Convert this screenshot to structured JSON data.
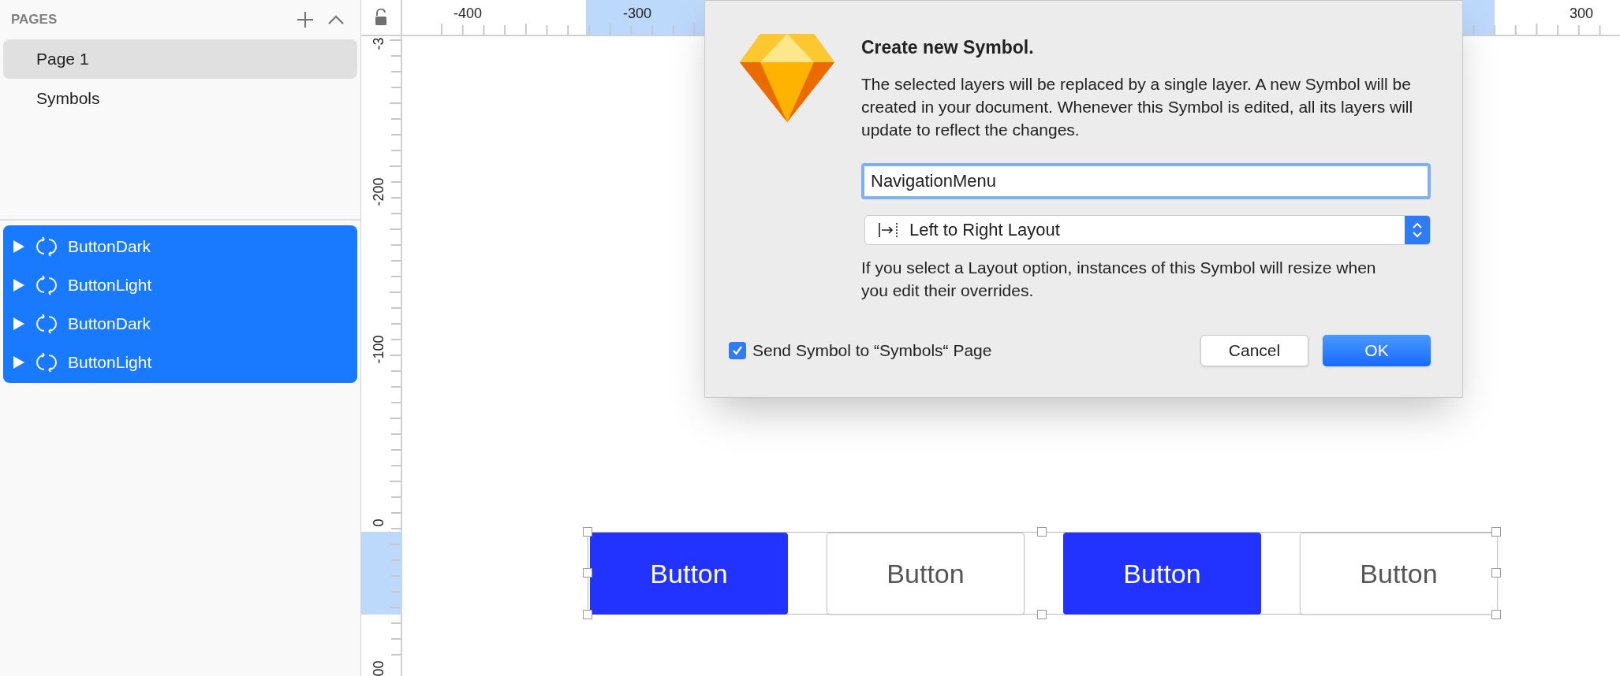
{
  "pages": {
    "title": "PAGES",
    "items": [
      {
        "label": "Page 1",
        "selected": true
      },
      {
        "label": "Symbols",
        "selected": false
      }
    ]
  },
  "layers": [
    {
      "name": "ButtonDark",
      "selected": true
    },
    {
      "name": "ButtonLight",
      "selected": true
    },
    {
      "name": "ButtonDark",
      "selected": true
    },
    {
      "name": "ButtonLight",
      "selected": true
    }
  ],
  "ruler": {
    "horizontal": [
      "-400",
      "-300",
      "300"
    ],
    "vertical": [
      "-3",
      "-200",
      "-100",
      "0",
      "00"
    ]
  },
  "dialog": {
    "title": "Create new Symbol.",
    "message": "The selected layers will be replaced by a single layer. A new Symbol will be created in your document. Whenever this Symbol is edited, all its layers will update to reflect the changes.",
    "name_value": "NavigationMenu",
    "layout_select": "Left to Right Layout",
    "hint": "If you select a Layout option, instances of this Symbol will resize when you edit their overrides.",
    "send_to_symbols": {
      "label": "Send Symbol to “Symbols“ Page",
      "checked": true
    },
    "buttons": [
      {
        "label": "Cancel",
        "kind": "secondary"
      },
      {
        "label": "OK",
        "kind": "primary"
      }
    ]
  },
  "canvas_buttons": [
    {
      "label": "Button",
      "kind": "dark"
    },
    {
      "label": "Button",
      "kind": "light"
    },
    {
      "label": "Button",
      "kind": "dark"
    },
    {
      "label": "Button",
      "kind": "light"
    }
  ]
}
